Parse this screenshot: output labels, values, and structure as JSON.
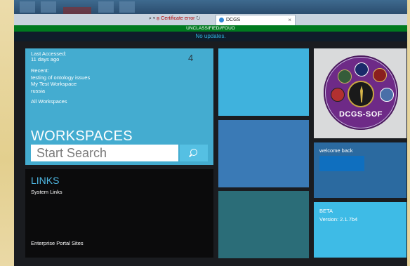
{
  "browser": {
    "address_controls": "⌕ ▾",
    "certificate_error": "⊗ Certificate error",
    "refresh_icon": "refresh-icon",
    "tab_title": "DCGS",
    "tab_close": "×"
  },
  "banners": {
    "classification": "UNCLASSIFIED//FOUO",
    "updates": "No updates."
  },
  "workspaces": {
    "last_accessed_label": "Last Accessed:",
    "last_accessed_value": "11 days ago",
    "count": "4",
    "recent_label": "Recent:",
    "recent_items": [
      "testing of ontology issues",
      "My Test Workspace",
      "russia"
    ],
    "all_workspaces": "All Workspaces",
    "title": "WORKSPACES",
    "search_placeholder": "Start Search"
  },
  "links": {
    "title": "LINKS",
    "system_links": "System Links",
    "enterprise_portal_sites": "Enterprise Portal Sites"
  },
  "logo": {
    "seal_text": "DCGS-SOF"
  },
  "welcome": {
    "label": "welcome back"
  },
  "beta": {
    "label": "BETA",
    "version": "Version: 2.1.7b4"
  },
  "colors": {
    "classification_green": "#007a1f",
    "updates_text": "#2fb3e0",
    "workspaces_tile": "#44acd0",
    "links_title": "#4fb7e2"
  }
}
